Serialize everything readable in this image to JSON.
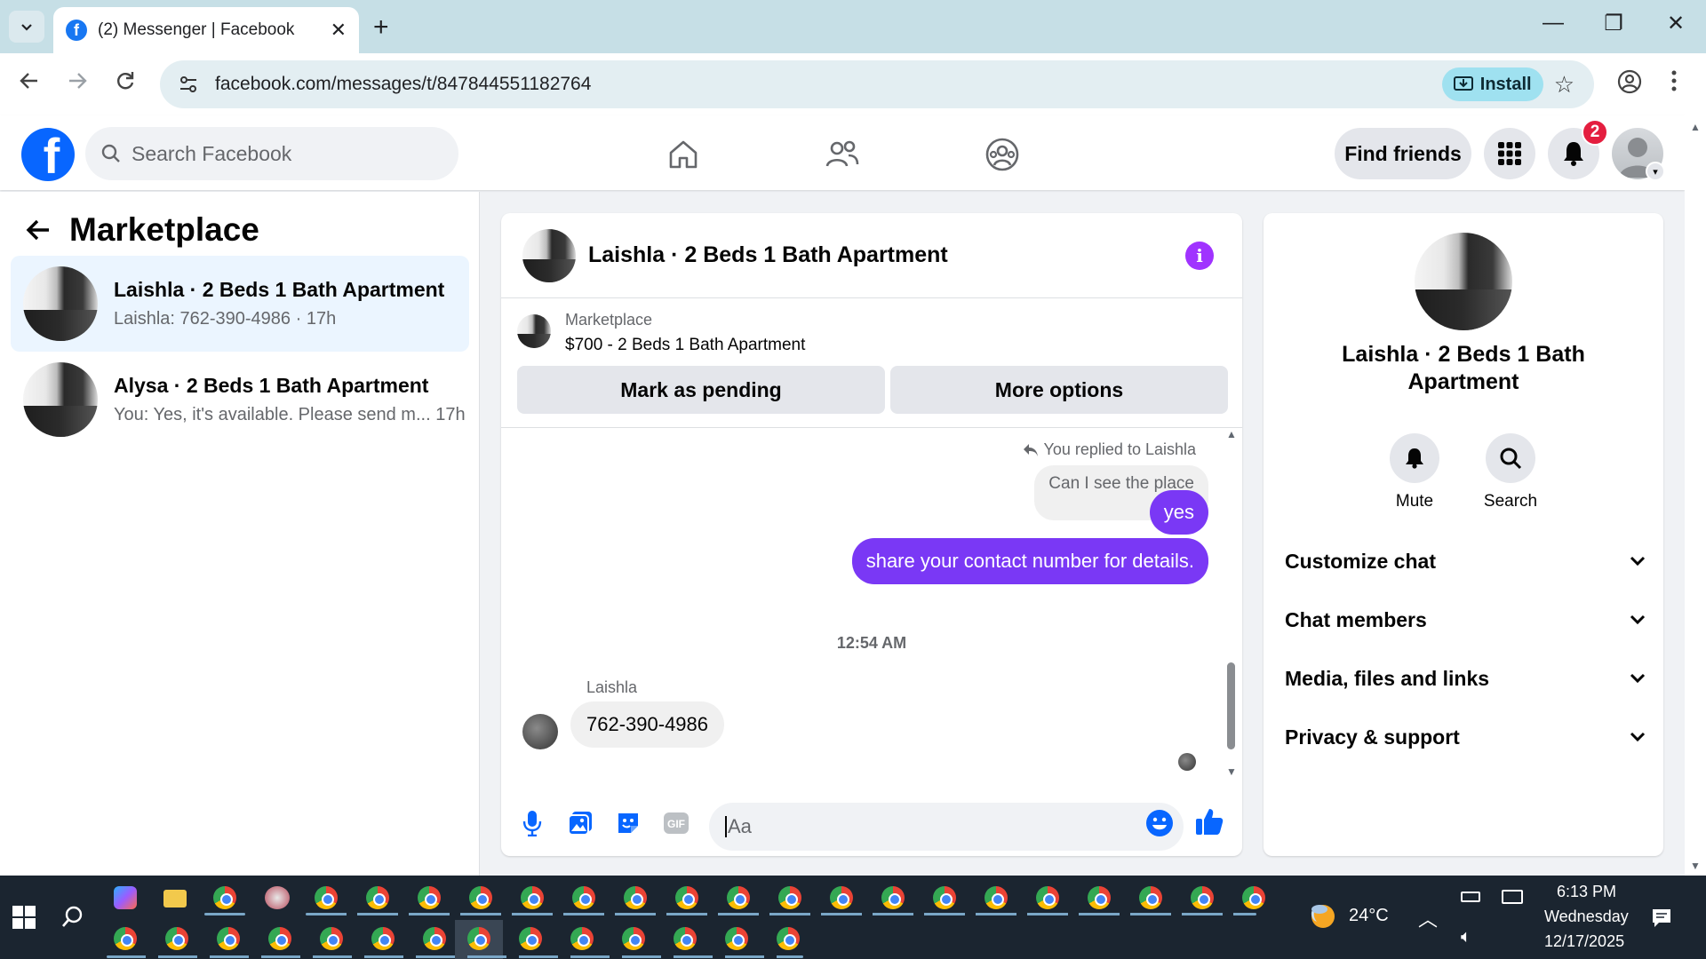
{
  "browser": {
    "tab_title": "(2) Messenger | Facebook",
    "url": "facebook.com/messages/t/847844551182764",
    "install_label": "Install"
  },
  "fb_nav": {
    "search_placeholder": "Search Facebook",
    "find_friends_label": "Find friends",
    "notification_count": "2",
    "brand_color": "#0866ff"
  },
  "left_panel": {
    "title": "Marketplace",
    "conversations": [
      {
        "name": "Laishla · 2 Beds 1 Bath Apartment",
        "preview": "Laishla: 762-390-4986 · 17h",
        "active": true
      },
      {
        "name": "Alysa · 2 Beds 1 Bath Apartment",
        "preview": "You: Yes, it's available. Please send m...  17h",
        "active": false
      }
    ]
  },
  "chat": {
    "title": "Laishla · 2 Beds 1 Bath Apartment",
    "listing_category": "Marketplace",
    "listing_title": "$700 - 2 Beds 1 Bath Apartment",
    "mark_pending_label": "Mark as pending",
    "more_options_label": "More options",
    "replied_note": "You replied to Laishla",
    "quoted_message": "Can I see the place",
    "outgoing": [
      "yes",
      "share your contact  number for details."
    ],
    "timestamp": "12:54 AM",
    "sender_name": "Laishla",
    "incoming": "762-390-4986",
    "composer_placeholder": "Aa",
    "accent_color": "#7a38f5"
  },
  "right_panel": {
    "name": "Laishla · 2 Beds 1 Bath Apartment",
    "mute_label": "Mute",
    "search_label": "Search",
    "sections": [
      "Customize chat",
      "Chat members",
      "Media, files and links",
      "Privacy & support"
    ]
  },
  "taskbar": {
    "temperature": "24°C",
    "time": "6:13 PM",
    "day": "Wednesday",
    "date": "12/17/2025"
  }
}
